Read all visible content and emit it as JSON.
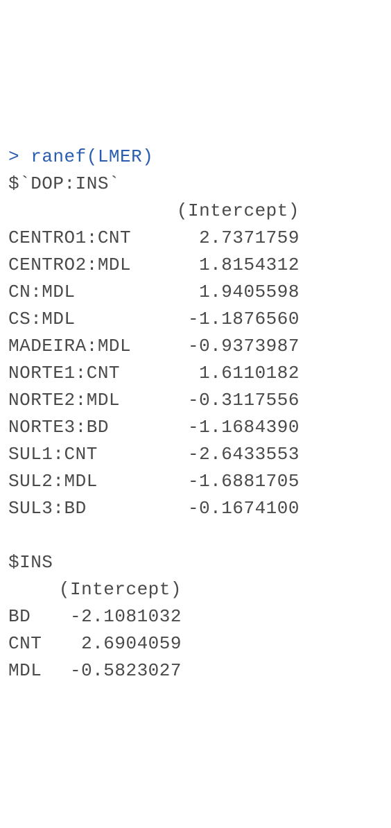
{
  "prompt": "> ",
  "command": "ranef(LMER)",
  "group1": {
    "name": "$`DOP:INS`",
    "header": "(Intercept)",
    "rows": [
      {
        "label": "CENTRO1:CNT",
        "value": "2.7371759"
      },
      {
        "label": "CENTRO2:MDL",
        "value": "1.8154312"
      },
      {
        "label": "CN:MDL",
        "value": "1.9405598"
      },
      {
        "label": "CS:MDL",
        "value": "-1.1876560"
      },
      {
        "label": "MADEIRA:MDL",
        "value": "-0.9373987"
      },
      {
        "label": "NORTE1:CNT",
        "value": "1.6110182"
      },
      {
        "label": "NORTE2:MDL",
        "value": "-0.3117556"
      },
      {
        "label": "NORTE3:BD",
        "value": "-1.1684390"
      },
      {
        "label": "SUL1:CNT",
        "value": "-2.6433553"
      },
      {
        "label": "SUL2:MDL",
        "value": "-1.6881705"
      },
      {
        "label": "SUL3:BD",
        "value": "-0.1674100"
      }
    ]
  },
  "group2": {
    "name": "$INS",
    "header": "(Intercept)",
    "rows": [
      {
        "label": "BD",
        "value": "-2.1081032"
      },
      {
        "label": "CNT",
        "value": "2.6904059"
      },
      {
        "label": "MDL",
        "value": "-0.5823027"
      }
    ]
  }
}
